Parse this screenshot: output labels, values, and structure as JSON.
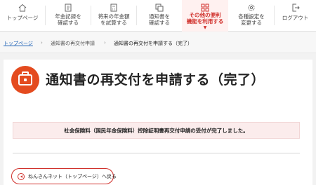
{
  "nav": {
    "items": [
      {
        "label": "トップページ",
        "icon": "home-icon"
      },
      {
        "label": "年金記録を\n確認する",
        "icon": "document-icon"
      },
      {
        "label": "将来の年金額\nを試算する",
        "icon": "calculator-icon"
      },
      {
        "label": "通知書を\n確認する",
        "icon": "copy-icon"
      },
      {
        "label": "その他の便利\n機能を利用する",
        "icon": "grid-icon"
      },
      {
        "label": "各種設定を\n変更する",
        "icon": "gear-icon"
      },
      {
        "label": "ログアウト",
        "icon": "logout-icon"
      }
    ],
    "active_index": 4,
    "accent": "#d0302b"
  },
  "breadcrumb": {
    "home": "トップページ",
    "level2": "通知書の再交付申請",
    "current": "通知書の再交付を申請する（完了）"
  },
  "page": {
    "title": "通知書の再交付を申請する（完了）",
    "badge_icon": "briefcase-icon",
    "badge_color": "#e44b1f"
  },
  "notice": {
    "text": "社会保険料（国民年金保険料）控除証明書再交付申請の受付が完了しました。"
  },
  "back_button": {
    "label": "ねんきんネット（トップページ）へ戻る"
  }
}
